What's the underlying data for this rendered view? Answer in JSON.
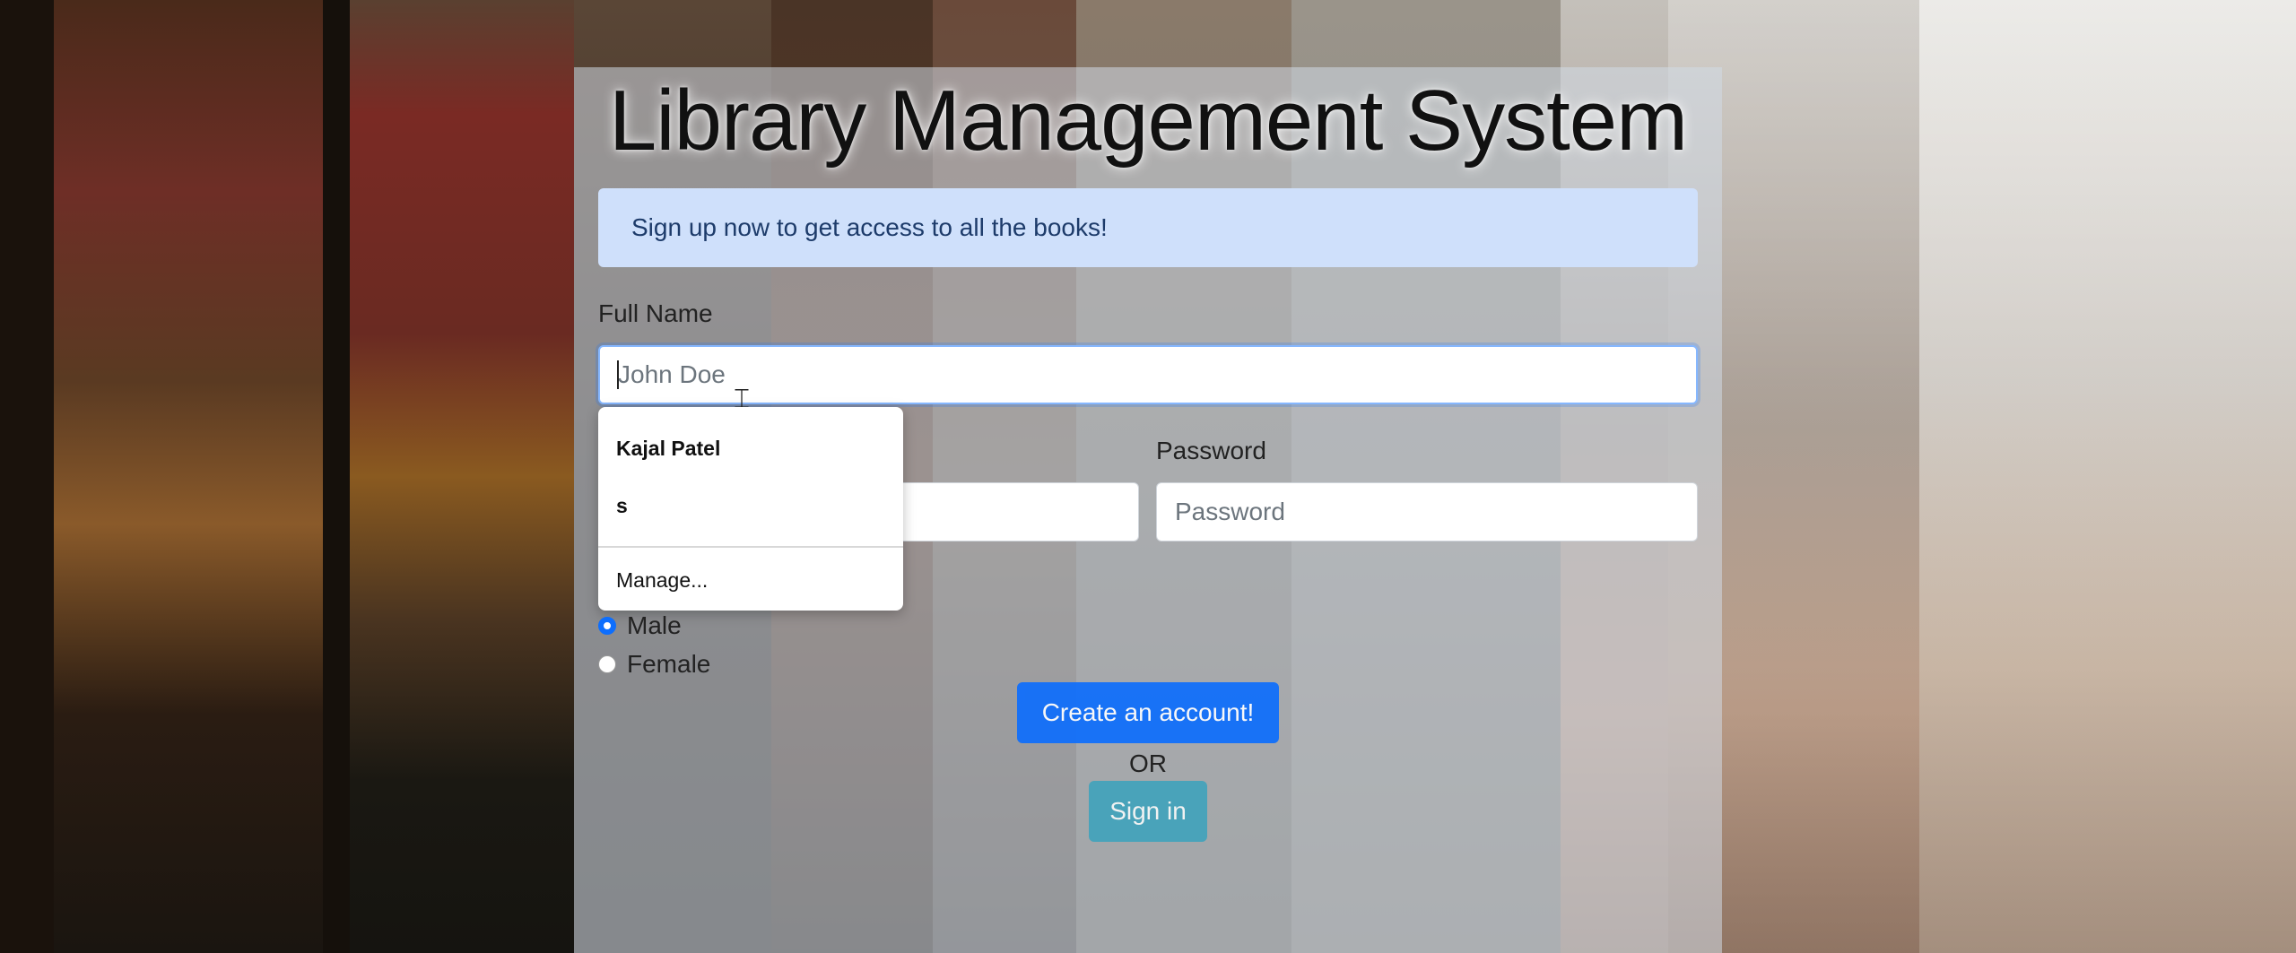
{
  "page": {
    "title": "Library Management System",
    "alert": "Sign up now to get access to all the books!"
  },
  "form": {
    "full_name": {
      "label": "Full Name",
      "placeholder": "John Doe",
      "value": ""
    },
    "email": {
      "value": ""
    },
    "password": {
      "label": "Password",
      "placeholder": "Password",
      "value": ""
    },
    "gender": {
      "options": [
        "Male",
        "Female"
      ],
      "selected": "Male"
    },
    "create_button": "Create an account!",
    "or_text": "OR",
    "signin_button": "Sign in"
  },
  "autocomplete": {
    "items": [
      "Kajal Patel",
      "s"
    ],
    "manage_label": "Manage..."
  },
  "colors": {
    "primary": "#0d6efd",
    "info": "#3aa3bd",
    "alert_bg": "#cfe0fb",
    "alert_text": "#1d3b6a"
  }
}
